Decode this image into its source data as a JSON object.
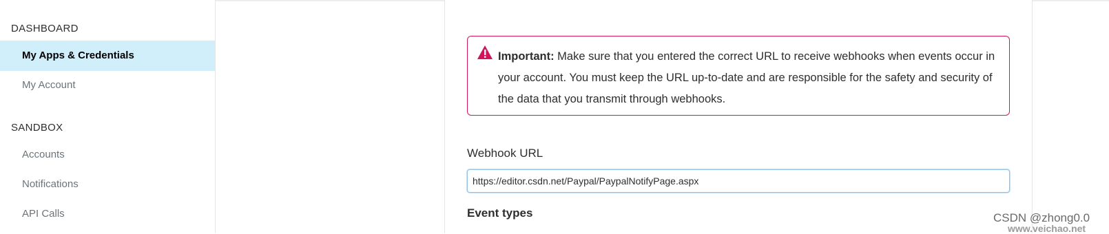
{
  "sidebar": {
    "dashboard_heading": "DASHBOARD",
    "dashboard_items": [
      {
        "label": "My Apps & Credentials",
        "active": true
      },
      {
        "label": "My Account",
        "active": false
      }
    ],
    "sandbox_heading": "SANDBOX",
    "sandbox_items": [
      {
        "label": "Accounts"
      },
      {
        "label": "Notifications"
      },
      {
        "label": "API Calls"
      }
    ]
  },
  "alert": {
    "icon": "warning-triangle-icon",
    "strong": "Important:",
    "text": " Make sure that you entered the correct URL to receive webhooks when events occur in your account. You must keep the URL up-to-date and are responsible for the safety and security of the data that you transmit through webhooks.",
    "border_color": "#d1145a"
  },
  "webhook": {
    "label": "Webhook URL",
    "value": "https://editor.csdn.net/Paypal/PaypalNotifyPage.aspx"
  },
  "event_types": {
    "title": "Event types"
  },
  "watermark": {
    "line1": "CSDN @zhong0.0",
    "line2": "www.veichao.net"
  },
  "colors": {
    "active_nav_bg": "#d1effa",
    "alert_accent": "#d1145a",
    "input_focus": "#8fc3ea"
  }
}
